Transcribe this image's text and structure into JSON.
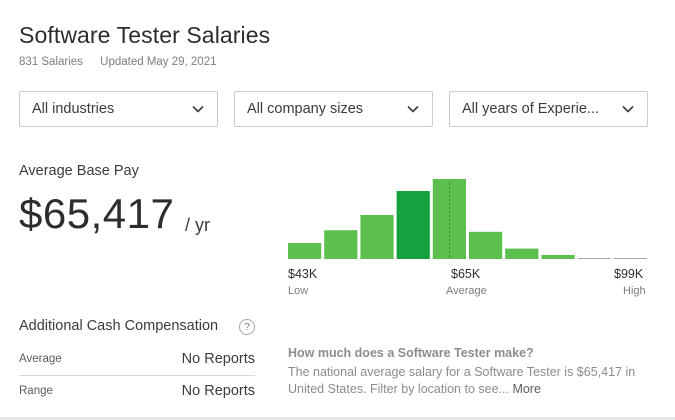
{
  "header": {
    "title": "Software Tester Salaries",
    "salaries_count": "831 Salaries",
    "updated": "Updated May 29, 2021"
  },
  "filters": [
    {
      "label": "All industries"
    },
    {
      "label": "All company sizes"
    },
    {
      "label": "All years of Experie..."
    }
  ],
  "pay": {
    "label": "Average Base Pay",
    "amount": "$65,417",
    "unit": "/ yr"
  },
  "histogram": {
    "bar_heights_fraction": [
      0.2,
      0.36,
      0.55,
      0.85,
      1.0,
      0.34,
      0.13,
      0.05,
      0.01,
      0.01
    ],
    "highlight_index": 3,
    "average_marker_index": 4,
    "colors": {
      "bar": "#5cbf4e",
      "highlight": "#14a23e",
      "empty": "#a8a9ab",
      "dotted": "#1e8e3e"
    },
    "ticks": {
      "low": "$43K",
      "mid": "$65K",
      "high": "$99K"
    },
    "tick_labels": {
      "low": "Low",
      "mid": "Average",
      "high": "High"
    }
  },
  "additional": {
    "title": "Additional Cash Compensation",
    "help_icon": "?",
    "rows": [
      {
        "label": "Average",
        "value": "No Reports"
      },
      {
        "label": "Range",
        "value": "No Reports"
      }
    ]
  },
  "faq": {
    "question": "How much does a Software Tester make?",
    "answer": "The national average salary for a Software Tester is $65,417 in United States. Filter by location to see...",
    "more": "More"
  }
}
